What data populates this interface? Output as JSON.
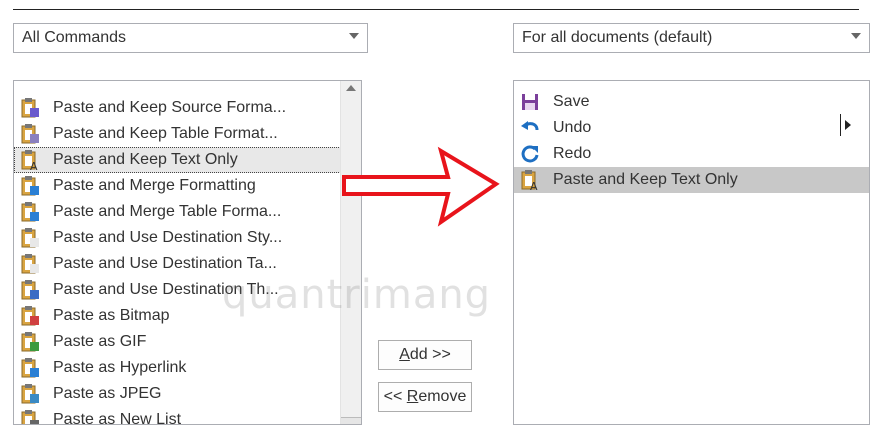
{
  "left_dropdown": {
    "value": "All Commands"
  },
  "right_dropdown": {
    "value": "For all documents (default)"
  },
  "commands": [
    {
      "label": "Paste and Keep Source Forma...",
      "icon": "paste-source-icon"
    },
    {
      "label": "Paste and Keep Table Format...",
      "icon": "paste-table-icon"
    },
    {
      "label": "Paste and Keep Text Only",
      "icon": "paste-text-icon",
      "selected": true
    },
    {
      "label": "Paste and Merge Formatting",
      "icon": "paste-merge-icon"
    },
    {
      "label": "Paste and Merge Table Forma...",
      "icon": "paste-merge-table-icon"
    },
    {
      "label": "Paste and Use Destination Sty...",
      "icon": "paste-destination-icon"
    },
    {
      "label": "Paste and Use Destination Ta...",
      "icon": "paste-destination-table-icon"
    },
    {
      "label": "Paste and Use Destination Th...",
      "icon": "paste-destination-theme-icon"
    },
    {
      "label": "Paste as Bitmap",
      "icon": "paste-bitmap-icon"
    },
    {
      "label": "Paste as GIF",
      "icon": "paste-gif-icon"
    },
    {
      "label": "Paste as Hyperlink",
      "icon": "paste-hyperlink-icon"
    },
    {
      "label": "Paste as JPEG",
      "icon": "paste-jpeg-icon"
    },
    {
      "label": "Paste as New List",
      "icon": "paste-new-list-icon"
    }
  ],
  "toolbar_items": [
    {
      "label": "Save",
      "icon": "save-icon"
    },
    {
      "label": "Undo",
      "icon": "undo-icon"
    },
    {
      "label": "Redo",
      "icon": "redo-icon"
    },
    {
      "label": "Paste and Keep Text Only",
      "icon": "paste-text-icon",
      "selected": true
    }
  ],
  "buttons": {
    "add_prefix": "",
    "add_key": "A",
    "add_rest": "dd >>",
    "remove_prefix": "<< ",
    "remove_key": "R",
    "remove_rest": "emove"
  },
  "watermark": "quantrimang",
  "colors": {
    "arrow": "#e8141b",
    "selection_right": "#c8c8c8",
    "save": "#7b3f9b",
    "undo_redo": "#1e6fc2"
  }
}
